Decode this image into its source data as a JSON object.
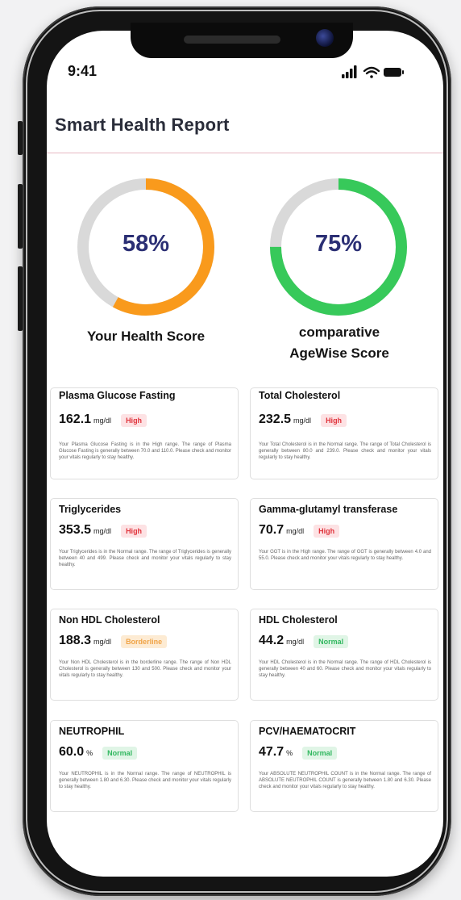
{
  "status_bar": {
    "time": "9:41"
  },
  "header": {
    "title": "Smart  Health Report"
  },
  "scores": [
    {
      "label": "Your Health Score",
      "label_line2": "",
      "percent_text": "58%",
      "value": 0.58,
      "color": "#f99a1c"
    },
    {
      "label": "comparative",
      "label_line2": "AgeWise Score",
      "percent_text": "75%",
      "value": 0.75,
      "color": "#37c95a"
    }
  ],
  "cards": [
    {
      "name": "Plasma Glucose Fasting",
      "value": "162.1",
      "unit": "mg/dl",
      "status": "High",
      "status_type": "high",
      "description": "Your Plasma Glucose Fasting is in the High range. The range of Plasma Glucose Fasting is generally between 70.0 and 110.0. Please check and monitor your vitals regularly to stay healthy."
    },
    {
      "name": "Total Cholesterol",
      "value": "232.5",
      "unit": "mg/dl",
      "status": "High",
      "status_type": "high",
      "description": "Your Total Cholesterol is in the Normal range. The range of Total Cholesterol is generally between 80.0 and 239.0. Please check and monitor your vitals regularly to stay healthy."
    },
    {
      "name": "Triglycerides",
      "value": "353.5",
      "unit": "mg/dl",
      "status": "High",
      "status_type": "high",
      "description": "Your Triglycerides is in the Normal range. The range of Triglycerides is generally between 40 and 499. Please check and monitor your vitals regularly to stay healthy."
    },
    {
      "name": "Gamma-glutamyl transferase",
      "value": "70.7",
      "unit": "mg/dl",
      "status": "High",
      "status_type": "high",
      "description": "Your GGT is in the High range. The range of GGT is generally between 4.0 and 55.0. Please check and monitor your vitals regularly to stay healthy."
    },
    {
      "name": "Non HDL Cholesterol",
      "value": "188.3",
      "unit": "mg/dl",
      "status": "Borderline",
      "status_type": "borderline",
      "description": "Your Non HDL Cholesterol is in the borderline range. The range of Non HDL Cholesterol is generally between 130 and 500. Please check and monitor your vitals regularly to stay healthy."
    },
    {
      "name": "HDL Cholesterol",
      "value": "44.2",
      "unit": "mg/dl",
      "status": "Normal",
      "status_type": "normal",
      "description": "Your HDL Cholesterol is in the Normal range. The range of HDL Cholesterol is generally between 40 and 60. Please check and monitor your vitals regularly to stay healthy."
    },
    {
      "name": "NEUTROPHIL",
      "value": "60.0",
      "unit": "%",
      "status": "Normal",
      "status_type": "normal",
      "description": "Your NEUTROPHIL is in the Normal range. The range of NEUTROPHIL is generally between 1.80 and 6.30. Please check and monitor your vitals regularly to stay healthy."
    },
    {
      "name": "PCV/HAEMATOCRIT",
      "value": "47.7",
      "unit": "%",
      "status": "Normal",
      "status_type": "normal",
      "description": "Your ABSOLUTE NEUTROPHIL COUNT is in the Normal range. The range of ABSOLUTE NEUTROPHIL COUNT is generally between 1.80 and 6.30. Please check and monitor your vitals regularly to stay healthy."
    }
  ]
}
